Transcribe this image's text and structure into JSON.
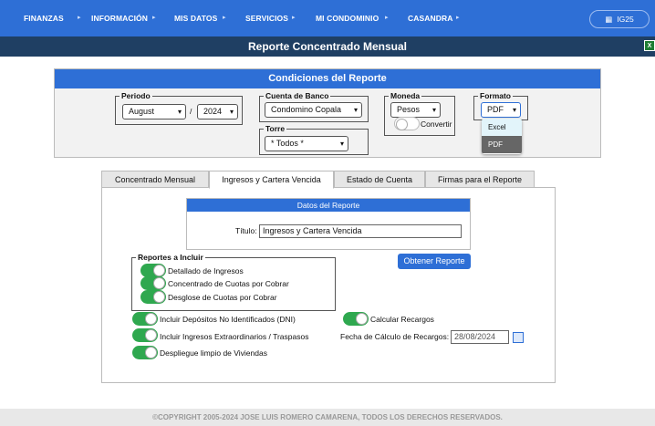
{
  "nav": {
    "items": [
      "FINANZAS",
      "INFORMACIÓN",
      "MIS DATOS",
      "SERVICIOS",
      "MI CONDOMINIO",
      "CASANDRA"
    ],
    "user": "IG25"
  },
  "title": "Reporte Concentrado Mensual",
  "conditions": {
    "header": "Condiciones del Reporte",
    "periodo": {
      "legend": "Periodo",
      "month": "August",
      "sep": "/",
      "year": "2024"
    },
    "cuenta": {
      "legend": "Cuenta de Banco",
      "value": "Condomino Copala"
    },
    "torre": {
      "legend": "Torre",
      "value": "* Todos *"
    },
    "moneda": {
      "legend": "Moneda",
      "value": "Pesos",
      "convertir": "Convertir"
    },
    "formato": {
      "legend": "Formato",
      "value": "PDF",
      "options": [
        "Excel",
        "PDF"
      ]
    }
  },
  "tabs": [
    "Concentrado Mensual",
    "Ingresos y Cartera Vencida",
    "Estado de Cuenta",
    "Firmas para el Reporte"
  ],
  "datos": {
    "header": "Datos del Reporte",
    "titulo_label": "Título:",
    "titulo_value": "Ingresos y Cartera Vencida"
  },
  "obtener": "Obtener Reporte",
  "reportes": {
    "legend": "Reportes a Incluir",
    "items": [
      "Detallado de Ingresos",
      "Concentrado de Cuotas por Cobrar",
      "Desglose de Cuotas por Cobrar"
    ]
  },
  "opts": {
    "dni": "Incluir Depósitos No Identificados (DNI)",
    "extra": "Incluir Ingresos Extraordinarios / Traspasos",
    "limpio": "Despliegue limpio de Viviendas",
    "recargos": "Calcular Recargos",
    "fecha_label": "Fecha de Cálculo de Recargos:",
    "fecha_value": "28/08/2024"
  },
  "footer": "©COPYRIGHT 2005-2024 JOSE LUIS ROMERO CAMARENA, TODOS LOS DERECHOS RESERVADOS.",
  "colors": {
    "nav": "#2e6fd6",
    "titlebar": "#1f3f63",
    "toggle_on": "#2fa84f"
  }
}
